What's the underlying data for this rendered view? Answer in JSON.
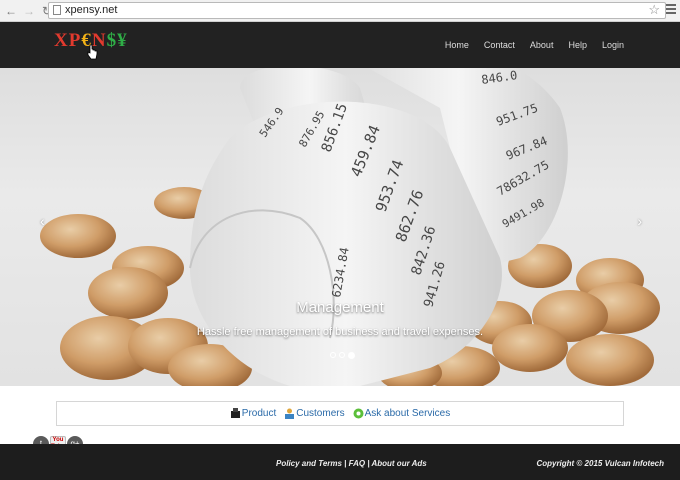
{
  "browser": {
    "url": "xpensy.net"
  },
  "logo": {
    "letters": [
      "X",
      "P",
      "€",
      "N",
      "$",
      "¥"
    ]
  },
  "nav": {
    "items": [
      "Home",
      "Contact",
      "About",
      "Help",
      "Login"
    ]
  },
  "carousel": {
    "title": "Management",
    "subtitle": "Hassle free management of business and travel expenses.",
    "slide_count": 3,
    "active_slide": 3,
    "receipt_numbers": [
      "846.0",
      "856.15",
      "876.95",
      "459.84",
      "953.74",
      "862.76",
      "842.36",
      "941.26",
      "6234.84",
      "951.75",
      "967.84",
      "78632.75",
      "9491.98",
      "546.9"
    ]
  },
  "links": {
    "product": "Product",
    "customers": "Customers",
    "ask": "Ask about Services"
  },
  "social": {
    "twitter": "t",
    "youtube": "You Tube",
    "gplus": "g+"
  },
  "footer": {
    "policy": "Policy and Terms",
    "faq": "FAQ",
    "ads": "About our Ads",
    "sep": " | ",
    "copyright": "Copyright © 2015 Vulcan Infotech"
  }
}
